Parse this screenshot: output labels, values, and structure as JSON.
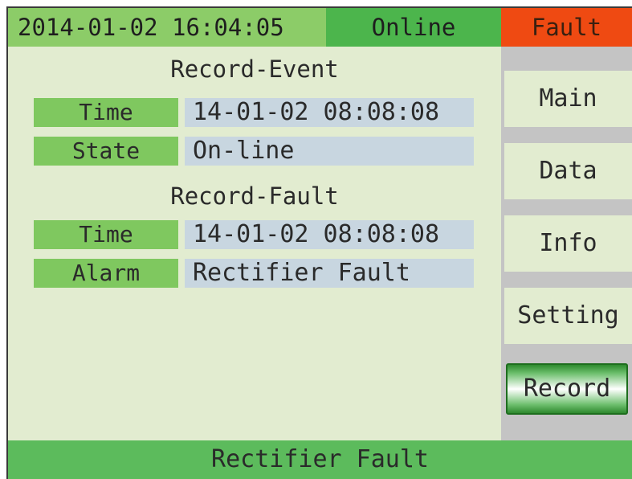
{
  "topbar": {
    "datetime": "2014-01-02 16:04:05",
    "status": "Online",
    "fault": "Fault"
  },
  "record_event": {
    "title": "Record-Event",
    "time_label": "Time",
    "time_value": "14-01-02 08:08:08",
    "state_label": "State",
    "state_value": "On-line"
  },
  "record_fault": {
    "title": "Record-Fault",
    "time_label": "Time",
    "time_value": "14-01-02 08:08:08",
    "alarm_label": "Alarm",
    "alarm_value": "Rectifier Fault"
  },
  "menu": {
    "items": [
      {
        "label": "Main"
      },
      {
        "label": "Data"
      },
      {
        "label": "Info"
      },
      {
        "label": "Setting"
      },
      {
        "label": "Record"
      }
    ],
    "active": "Record"
  },
  "bottombar": {
    "message": "Rectifier Fault"
  },
  "colors": {
    "background": "#e2ecd0",
    "label_green": "#7fc85f",
    "value_blue": "#c8d6e0",
    "online_green": "#4cb54c",
    "fault_red": "#ef4a12"
  }
}
